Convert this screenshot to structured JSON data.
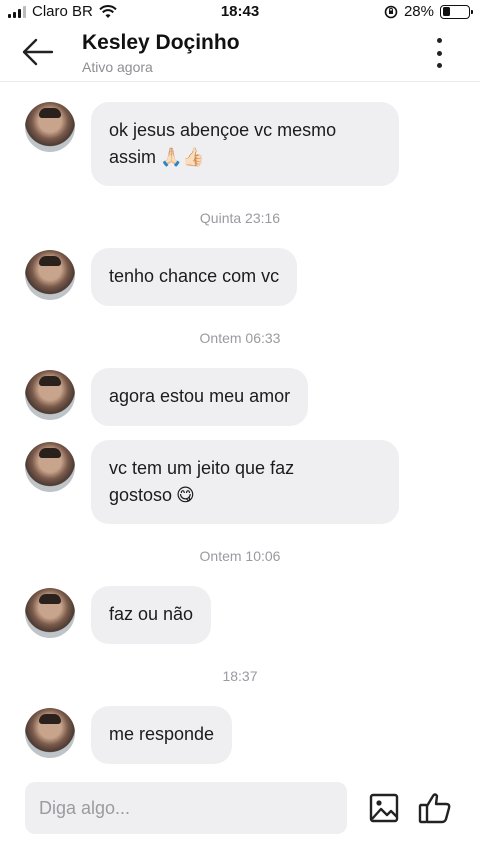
{
  "status_bar": {
    "carrier": "Claro BR",
    "time": "18:43",
    "battery": "28%",
    "battery_level": 0.28,
    "icons": [
      "signal-icon",
      "wifi-icon",
      "rotation-lock-icon",
      "battery-icon"
    ]
  },
  "header": {
    "name": "Kesley Doçinho",
    "presence": "Ativo agora",
    "icons": [
      "back-arrow-icon",
      "more-vertical-icon"
    ]
  },
  "messages": [
    {
      "type": "text",
      "text": "ok jesus abençoe vc mesmo",
      "text2": "assim",
      "emoji": "🙏🏻👍🏻"
    },
    {
      "type": "time",
      "text": "Quinta 23:16"
    },
    {
      "type": "text",
      "text": "tenho chance com vc"
    },
    {
      "type": "time",
      "text": "Ontem 06:33"
    },
    {
      "type": "text",
      "text": "agora estou meu amor"
    },
    {
      "type": "text",
      "text": "vc tem um jeito que faz",
      "text2": "gostoso",
      "emoji": "😋"
    },
    {
      "type": "time",
      "text": "Ontem 10:06"
    },
    {
      "type": "text",
      "text": "faz ou não"
    },
    {
      "type": "time",
      "text": "18:37"
    },
    {
      "type": "text",
      "text": "me responde"
    }
  ],
  "composer": {
    "placeholder": "Diga algo...",
    "icons": [
      "image-icon",
      "thumbs-up-icon"
    ]
  }
}
